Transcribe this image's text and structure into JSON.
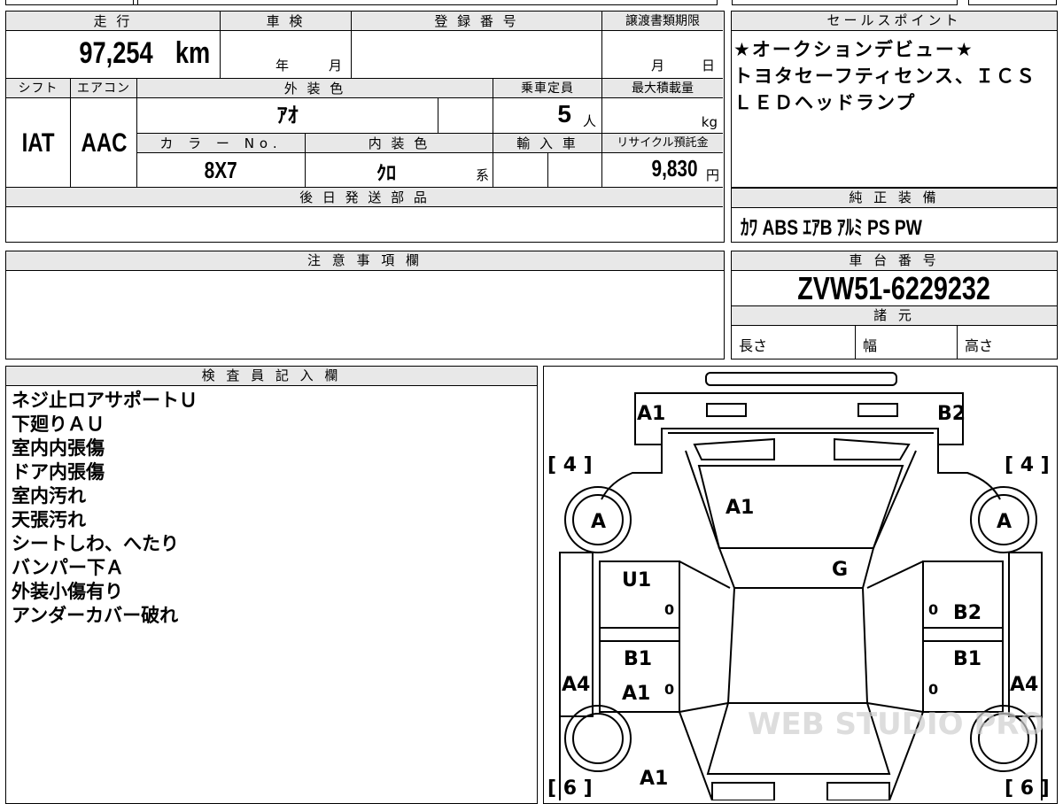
{
  "top_strip": "",
  "vehicle": {
    "labels": {
      "mileage": "走 行",
      "inspection": "車 検",
      "registration": "登 録 番 号",
      "transfer_deadline": "譲渡書類期限",
      "shift": "シフト",
      "aircon": "エアコン",
      "exterior_color": "外 装 色",
      "capacity": "乗車定員",
      "max_load": "最大積載量",
      "color_no": "カ ラ ー No.",
      "interior_color": "内 装 色",
      "import": "輸 入 車",
      "recycle": "リサイクル預託金",
      "later_parts": "後 日 発 送 部 品",
      "caution": "注 意 事 項 欄",
      "inspector": "検 査 員 記 入 欄"
    },
    "mileage": "97,254",
    "mileage_unit": "km",
    "inspection_year_unit": "年",
    "inspection_month_unit": "月",
    "deadline_month_unit": "月",
    "deadline_day_unit": "日",
    "shift": "IAT",
    "aircon": "AAC",
    "exterior_color": "ｱｵ",
    "capacity": "5",
    "capacity_unit": "人",
    "max_load_unit": "kg",
    "color_no": "8X7",
    "interior_color": "ｸﾛ",
    "interior_suffix": "系",
    "recycle_fee": "9,830",
    "recycle_unit": "円"
  },
  "sales_point": {
    "header": "セールスポイント",
    "lines": [
      "★オークションデビュー★",
      "トヨタセーフティセンス、ＩＣＳ",
      "ＬＥＤヘッドランプ"
    ]
  },
  "equipment": {
    "header": "純 正 装 備",
    "items": "ｶﾜ ABS ｴｱB ｱﾙﾐ PS PW"
  },
  "chassis": {
    "header": "車 台 番 号",
    "number": "ZVW51-6229232"
  },
  "specs": {
    "header": "諸 元",
    "length": "長さ",
    "width": "幅",
    "height": "高さ"
  },
  "inspector_notes": [
    "ネジ止ロアサポートＵ",
    "下廻りＡＵ",
    "室内内張傷",
    "ドア内張傷",
    "室内汚れ",
    "天張汚れ",
    "シートしわ、へたり",
    "バンパー下Ａ",
    "外装小傷有り",
    "アンダーカバー破れ"
  ],
  "diagram": {
    "front_left": "A1",
    "front_right": "B2",
    "hood": "A1",
    "windshield": "G",
    "tire_fl": "[ 4 ]",
    "tire_fr": "[ 4 ]",
    "tire_rl": "[ 6 ]",
    "tire_rr": "[ 6 ]",
    "wheel_fl": "A",
    "wheel_fr": "A",
    "fl_door": "U1",
    "fr_door": "B2",
    "rl_door_1": "B1",
    "rl_door_2": "A1",
    "rr_door": "B1",
    "left_rocker": "A4",
    "right_rocker": "A4",
    "rear": "A1",
    "zero": "0",
    "watermark": "WEB STUDIO PRO"
  }
}
